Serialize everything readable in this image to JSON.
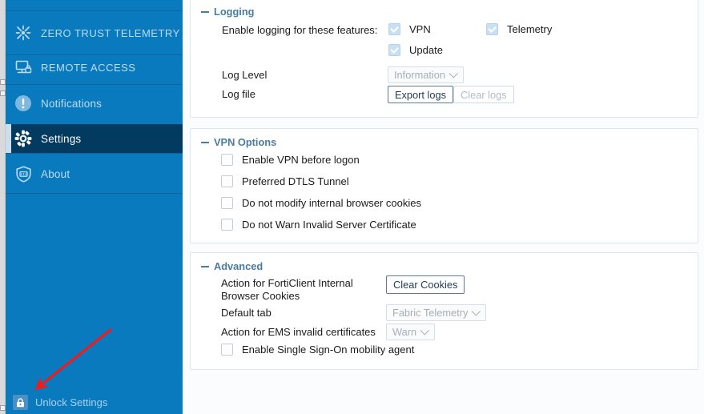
{
  "app": {
    "accent_blue": "#0a7abf",
    "active_navy": "#033a60",
    "panel_border": "#dbe7f0",
    "arrow_color": "#ee1c1c"
  },
  "sidebar": {
    "items": [
      {
        "label": "ZERO TRUST TELEMETRY",
        "icon": "telemetry-burst-icon",
        "active": false
      },
      {
        "label": "REMOTE ACCESS",
        "icon": "monitor-lock-icon",
        "active": false
      },
      {
        "label": "Notifications",
        "icon": "alert-circle-icon",
        "active": false
      },
      {
        "label": "Settings",
        "icon": "gear-icon",
        "active": true
      },
      {
        "label": "About",
        "icon": "shield-icon",
        "active": false
      }
    ],
    "unlock": {
      "label": "Unlock Settings",
      "icon": "lock-icon"
    }
  },
  "sections": {
    "logging": {
      "title": "Logging",
      "collapse_icon": "minus-icon",
      "enable_logging_label": "Enable logging for these features:",
      "features": [
        {
          "label": "VPN",
          "checked": true
        },
        {
          "label": "Telemetry",
          "checked": true
        },
        {
          "label": "Update",
          "checked": true
        }
      ],
      "log_level_label": "Log Level",
      "log_level_value": "Information",
      "log_file_label": "Log file",
      "export_logs_label": "Export logs",
      "clear_logs_label": "Clear logs"
    },
    "vpn_options": {
      "title": "VPN Options",
      "collapse_icon": "minus-icon",
      "options": [
        {
          "label": "Enable VPN before logon",
          "checked": false
        },
        {
          "label": "Preferred DTLS Tunnel",
          "checked": false
        },
        {
          "label": "Do not modify internal browser cookies",
          "checked": false
        },
        {
          "label": "Do not Warn Invalid Server Certificate",
          "checked": false
        }
      ]
    },
    "advanced": {
      "title": "Advanced",
      "collapse_icon": "minus-icon",
      "cookies_label": "Action for FortiClient Internal Browser Cookies",
      "clear_cookies_label": "Clear Cookies",
      "default_tab_label": "Default tab",
      "default_tab_value": "Fabric Telemetry",
      "ems_cert_label": "Action for EMS invalid certificates",
      "ems_cert_value": "Warn",
      "sso_label": "Enable Single Sign-On mobility agent",
      "sso_checked": false
    }
  }
}
